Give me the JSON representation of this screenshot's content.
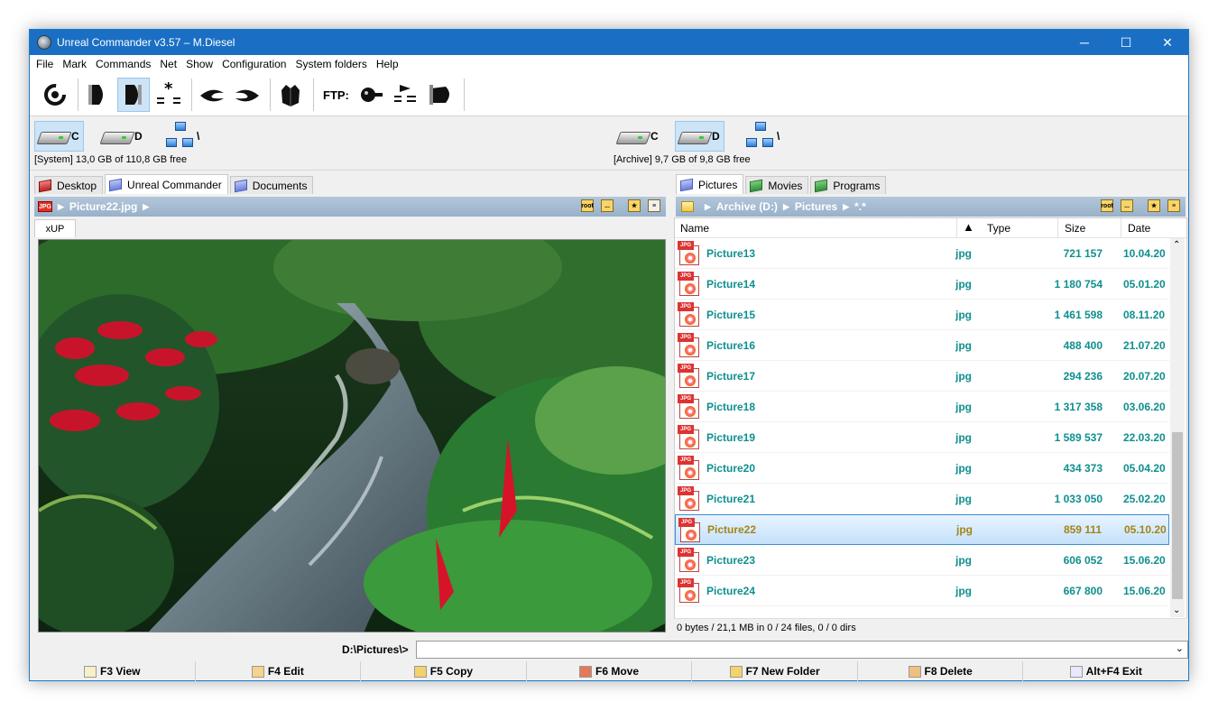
{
  "window": {
    "title": "Unreal Commander v3.57 – M.Diesel",
    "minimize": "─",
    "maximize": "☐",
    "close": "✕"
  },
  "menu": [
    "File",
    "Mark",
    "Commands",
    "Net",
    "Show",
    "Configuration",
    "System folders",
    "Help"
  ],
  "toolbar": {
    "ftp_label": "FTP:"
  },
  "left_drives": {
    "c_label": "C",
    "d_label": "D",
    "net_label": "\\",
    "info": "[System]  13,0 GB of  110,8 GB free"
  },
  "right_drives": {
    "c_label": "C",
    "d_label": "D",
    "net_label": "\\",
    "info": "[Archive]  9,7 GB of  9,8 GB free"
  },
  "left_tabs": [
    "Desktop",
    "Unreal Commander",
    "Documents"
  ],
  "right_tabs": [
    "Pictures",
    "Movies",
    "Programs"
  ],
  "left_path": {
    "text": "Picture22.jpg",
    "root": "root",
    "up": "..."
  },
  "viewer_tab": "xUP",
  "right_path": {
    "archive": "Archive (D:)",
    "folder": "Pictures",
    "mask": "*.*",
    "root": "root",
    "up": "..."
  },
  "columns": {
    "name": "Name",
    "type": "Type",
    "size": "Size",
    "date": "Date"
  },
  "files": [
    {
      "name": "Picture13",
      "type": "jpg",
      "size": "721 157",
      "date": "10.04.20"
    },
    {
      "name": "Picture14",
      "type": "jpg",
      "size": "1 180 754",
      "date": "05.01.20"
    },
    {
      "name": "Picture15",
      "type": "jpg",
      "size": "1 461 598",
      "date": "08.11.20"
    },
    {
      "name": "Picture16",
      "type": "jpg",
      "size": "488 400",
      "date": "21.07.20"
    },
    {
      "name": "Picture17",
      "type": "jpg",
      "size": "294 236",
      "date": "20.07.20"
    },
    {
      "name": "Picture18",
      "type": "jpg",
      "size": "1 317 358",
      "date": "03.06.20"
    },
    {
      "name": "Picture19",
      "type": "jpg",
      "size": "1 589 537",
      "date": "22.03.20"
    },
    {
      "name": "Picture20",
      "type": "jpg",
      "size": "434 373",
      "date": "05.04.20"
    },
    {
      "name": "Picture21",
      "type": "jpg",
      "size": "1 033 050",
      "date": "25.02.20"
    },
    {
      "name": "Picture22",
      "type": "jpg",
      "size": "859 111",
      "date": "05.10.20",
      "selected": true
    },
    {
      "name": "Picture23",
      "type": "jpg",
      "size": "606 052",
      "date": "15.06.20"
    },
    {
      "name": "Picture24",
      "type": "jpg",
      "size": "667 800",
      "date": "15.06.20"
    }
  ],
  "status": "0 bytes / 21,1 MB in 0 / 24 files, 0 / 0 dirs",
  "cmdline": {
    "prompt": "D:\\Pictures\\>",
    "value": ""
  },
  "fkeys": [
    "F3 View",
    "F4 Edit",
    "F5 Copy",
    "F6 Move",
    "F7 New Folder",
    "F8 Delete",
    "Alt+F4 Exit"
  ],
  "colors": {
    "titlebar": "#1a6fc4",
    "file_text": "#0f8f8f",
    "selected_text": "#a28518",
    "path_bar": "#a6bdd3"
  }
}
